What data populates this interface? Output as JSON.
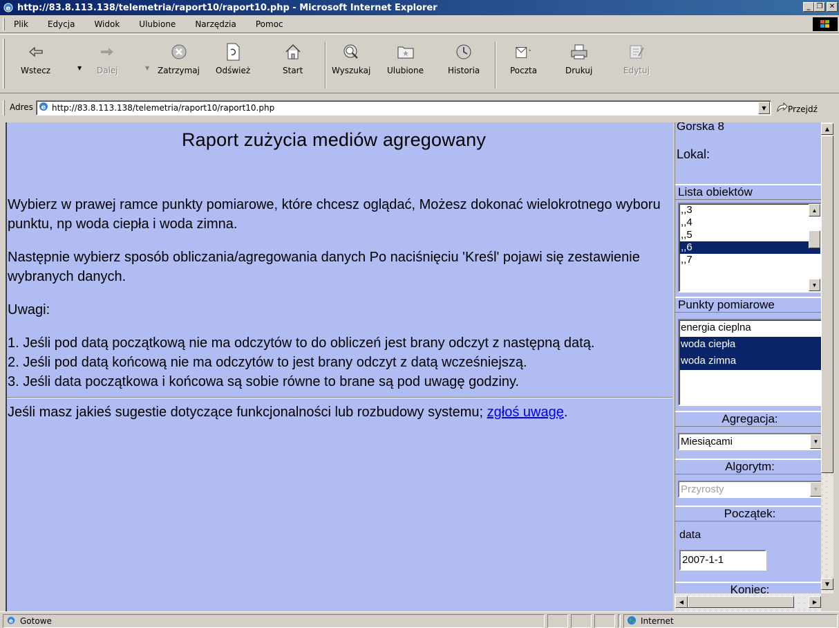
{
  "window": {
    "title": "http://83.8.113.138/telemetria/raport10/raport10.php - Microsoft Internet Explorer"
  },
  "menu": [
    "Plik",
    "Edycja",
    "Widok",
    "Ulubione",
    "Narzędzia",
    "Pomoc"
  ],
  "toolbar": {
    "back": "Wstecz",
    "forward": "Dalej",
    "stop": "Zatrzymaj",
    "refresh": "Odśwież",
    "home": "Start",
    "search": "Wyszukaj",
    "favorites": "Ulubione",
    "history": "Historia",
    "mail": "Poczta",
    "print": "Drukuj",
    "edit": "Edytuj"
  },
  "address": {
    "label": "Adres",
    "url": "http://83.8.113.138/telemetria/raport10/raport10.php",
    "go": "Przejdź"
  },
  "main": {
    "title": "Raport zużycia mediów agregowany",
    "intro": "Wybierz w prawej ramce punkty pomiarowe, które chcesz oglądać, Możesz dokonać wielokrotnego wyboru punktu, np woda ciepła i woda zimna.",
    "next": "Następnie wybierz sposób obliczania/agregowania danych Po naciśnięciu 'Kreśl' pojawi się zestawienie wybranych danych.",
    "notes_heading": "Uwagi:",
    "notes": [
      "1. Jeśli pod datą początkową nie ma odczytów to do obliczeń jest brany odczyt z następną datą.",
      "2. Jeśli pod datą końcową nie ma odczytów to jest brany odczyt z datą wcześniejszą.",
      "3. Jeśli data początkowa i końcowa są sobie równe to brane są pod uwagę godziny."
    ],
    "feedback_text": "Jeśli masz jakieś sugestie dotyczące funkcjonalności lub rozbudowy systemu;",
    "feedback_link": "zgłoś uwagę",
    "feedback_end": "."
  },
  "side": {
    "address_line": "Gorska 8",
    "lokal": "Lokal:",
    "objects_header": "Lista obiektów",
    "objects": [
      ",,3",
      ",,4",
      ",,5",
      ",,6",
      ",,7"
    ],
    "objects_selected": ",,6",
    "points_header": "Punkty pomiarowe",
    "points": [
      "energia cieplna",
      "woda ciepła",
      "woda zimna"
    ],
    "points_selected": [
      "woda ciepła",
      "woda zimna"
    ],
    "aggregation_header": "Agregacja:",
    "aggregation_value": "Miesiącami",
    "algorithm_header": "Algorytm:",
    "algorithm_value": "Przyrosty",
    "start_header": "Początek:",
    "date_label": "data",
    "date_value": "2007-1-1",
    "end_header": "Koniec:"
  },
  "status": {
    "text": "Gotowe",
    "zone": "Internet"
  }
}
